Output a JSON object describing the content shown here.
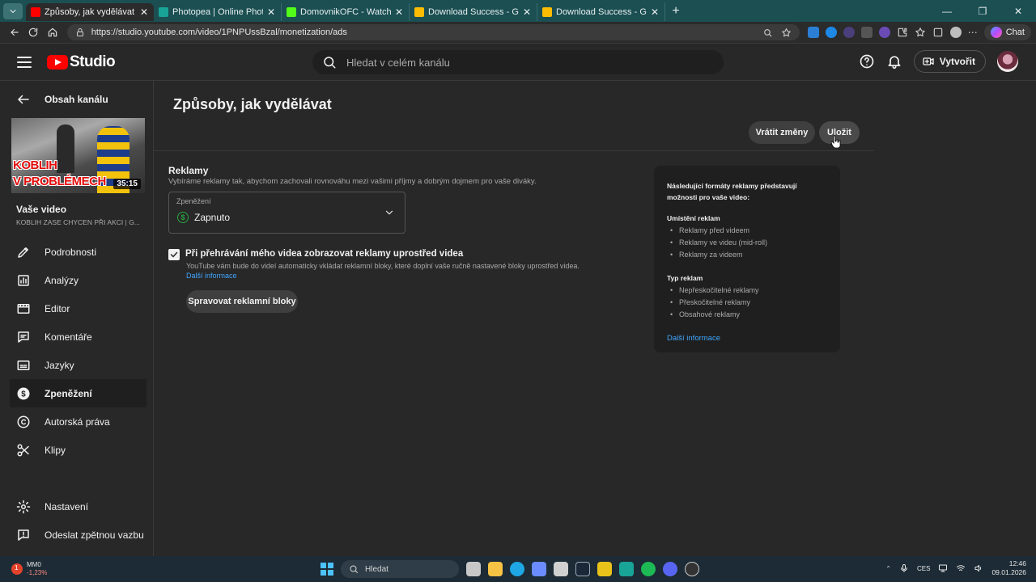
{
  "browser": {
    "tabs": [
      {
        "title": "Způsoby, jak vydělávat - YouTube",
        "color": "#ff0000"
      },
      {
        "title": "Photopea | Online Photo Editor",
        "color": "#18a497"
      },
      {
        "title": "DomovnikOFC - Watch the VOD o",
        "color": "#53fc18"
      },
      {
        "title": "Download Success - Google Fonts",
        "color": "#fbbc04"
      },
      {
        "title": "Download Success - Google Fonts",
        "color": "#fbbc04"
      }
    ],
    "url": "https://studio.youtube.com/video/1PNPUssBzal/monetization/ads",
    "chat_label": "Chat"
  },
  "header": {
    "logo_text": "Studio",
    "search_placeholder": "Hledat v celém kanálu",
    "create_label": "Vytvořit"
  },
  "sidebar": {
    "back_label": "Obsah kanálu",
    "thumbnail": {
      "line1": "KOBLIH",
      "line2": "V PROBLÉMECH",
      "duration": "35:15"
    },
    "video_heading": "Vaše video",
    "video_subtitle": "KOBLIH ZASE CHYCEN PŘI AKCI | G...",
    "items": [
      {
        "label": "Podrobnosti",
        "icon": "pencil-icon"
      },
      {
        "label": "Analýzy",
        "icon": "analytics-icon"
      },
      {
        "label": "Editor",
        "icon": "editor-icon"
      },
      {
        "label": "Komentáře",
        "icon": "comments-icon"
      },
      {
        "label": "Jazyky",
        "icon": "subtitles-icon"
      },
      {
        "label": "Zpeněžení",
        "icon": "dollar-icon",
        "active": true
      },
      {
        "label": "Autorská práva",
        "icon": "copyright-icon"
      },
      {
        "label": "Klipy",
        "icon": "scissors-icon"
      }
    ],
    "bottom": [
      {
        "label": "Nastavení",
        "icon": "gear-icon"
      },
      {
        "label": "Odeslat zpětnou vazbu",
        "icon": "feedback-icon"
      }
    ]
  },
  "main": {
    "title": "Způsoby, jak vydělávat",
    "revert_label": "Vrátit změny",
    "save_label": "Uložit",
    "section_title": "Reklamy",
    "section_desc": "Vybíráme reklamy tak, abychom zachovali rovnováhu mezi vašimi příjmy a dobrým dojmem pro vaše diváky.",
    "monetization": {
      "label": "Zpeněžení",
      "value": "Zapnuto"
    },
    "midroll": {
      "checked": true,
      "label": "Při přehrávání mého videa zobrazovat reklamy uprostřed videa",
      "desc": "YouTube vám bude do videí automaticky vkládat reklamní bloky, které doplní vaše ručně nastavené bloky uprostřed videa.",
      "link": "Další informace"
    },
    "manage_label": "Spravovat reklamní bloky"
  },
  "panel": {
    "intro": "Následující formáty reklamy představují možnosti pro vaše video:",
    "placement_heading": "Umístění reklam",
    "placements": [
      "Reklamy před videem",
      "Reklamy ve videu (mid-roll)",
      "Reklamy za videem"
    ],
    "type_heading": "Typ reklam",
    "types": [
      "Nepřeskočitelné reklamy",
      "Přeskočitelné reklamy",
      "Obsahové reklamy"
    ],
    "link": "Další informace"
  },
  "taskbar": {
    "weather_name": "MM0",
    "weather_change": "-1,23%",
    "search_label": "Hledat",
    "language": "CES",
    "time": "12:46",
    "date": "09.01.2026"
  }
}
